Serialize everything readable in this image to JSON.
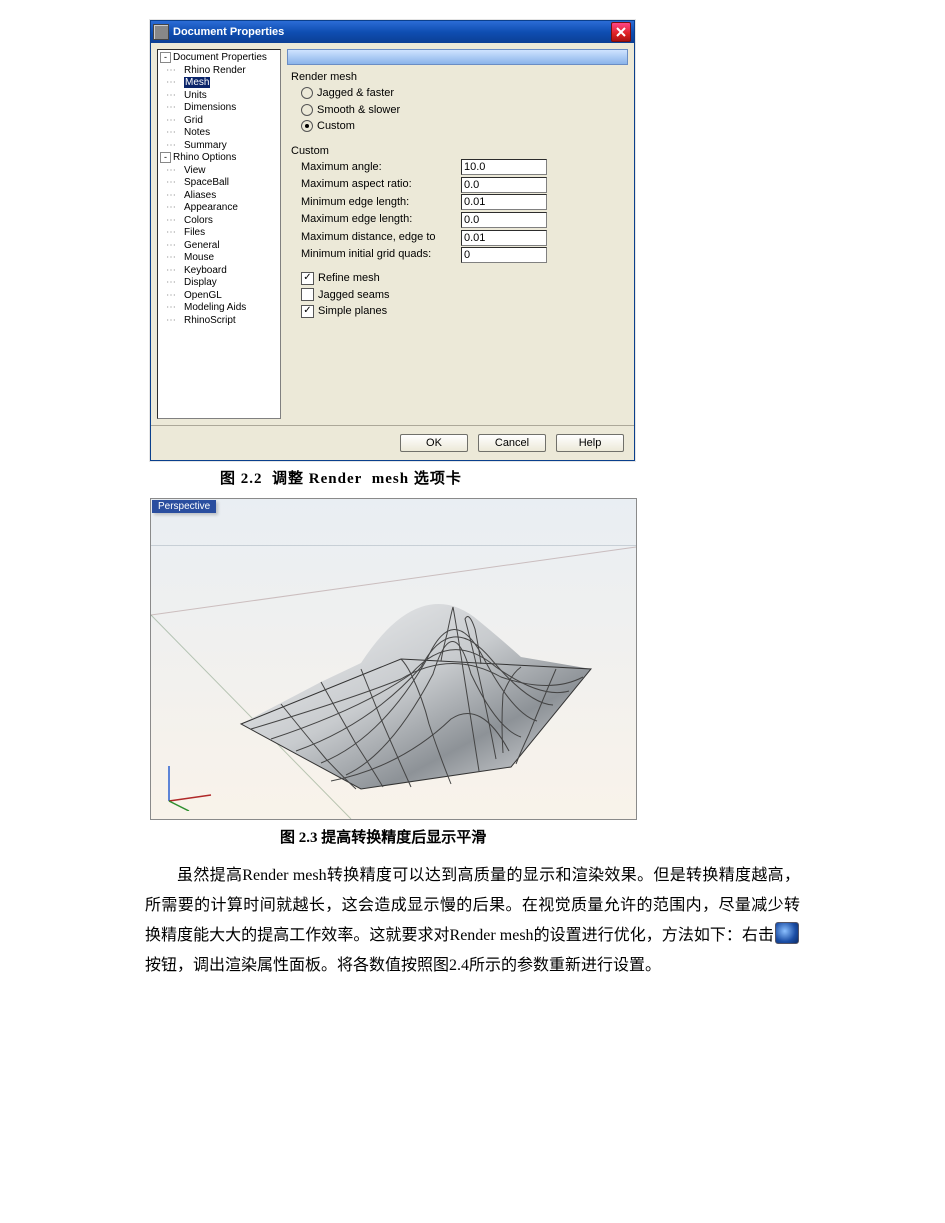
{
  "dialog": {
    "title": "Document Properties",
    "tree": {
      "root1": "Document Properties",
      "root1_items": [
        "Rhino Render",
        "Mesh",
        "Units",
        "Dimensions",
        "Grid",
        "Notes",
        "Summary"
      ],
      "selected": "Mesh",
      "root2": "Rhino Options",
      "root2_items": [
        "View",
        "SpaceBall",
        "Aliases",
        "Appearance",
        "Colors",
        "Files",
        "General",
        "Mouse",
        "Keyboard",
        "Display",
        "OpenGL",
        "Modeling Aids",
        "RhinoScript"
      ]
    },
    "render_mesh": {
      "heading": "Render mesh",
      "radios": [
        {
          "label": "Jagged & faster",
          "checked": false
        },
        {
          "label": "Smooth & slower",
          "checked": false
        },
        {
          "label": "Custom",
          "checked": true
        }
      ]
    },
    "custom": {
      "heading": "Custom",
      "fields": [
        {
          "label": "Maximum angle:",
          "value": "10.0"
        },
        {
          "label": "Maximum aspect ratio:",
          "value": "0.0"
        },
        {
          "label": "Minimum edge length:",
          "value": "0.01"
        },
        {
          "label": "Maximum edge length:",
          "value": "0.0"
        },
        {
          "label": "Maximum distance, edge to",
          "value": "0.01"
        },
        {
          "label": "Minimum initial grid quads:",
          "value": "0"
        }
      ],
      "checks": [
        {
          "label": "Refine mesh",
          "checked": true
        },
        {
          "label": "Jagged seams",
          "checked": false
        },
        {
          "label": "Simple planes",
          "checked": true
        }
      ]
    },
    "buttons": {
      "ok": "OK",
      "cancel": "Cancel",
      "help": "Help"
    }
  },
  "caption1_prefix": "图 2.2  调整 ",
  "caption1_en": "Render  mesh",
  "caption1_suffix": " 选项卡",
  "viewport_label": "Perspective",
  "caption2_prefix": "图 2.3 ",
  "caption2_text": "提高转换精度后显示平滑",
  "para1a": "虽然提高Render mesh转换精度可以达到高质量的显示和渲染效果。但是转换精度越高，所需要的计算时间就越长，这会造成显示慢的后果。在视觉质量允许的范围内，尽量减少转换精度能大大的提高工作效率。这就要求对Render mesh的设置进行优化，方法如下：右击",
  "para1b": "按钮，调出渲染属性面板。将各数值按照图2.4所示的参数重新进行设置。"
}
